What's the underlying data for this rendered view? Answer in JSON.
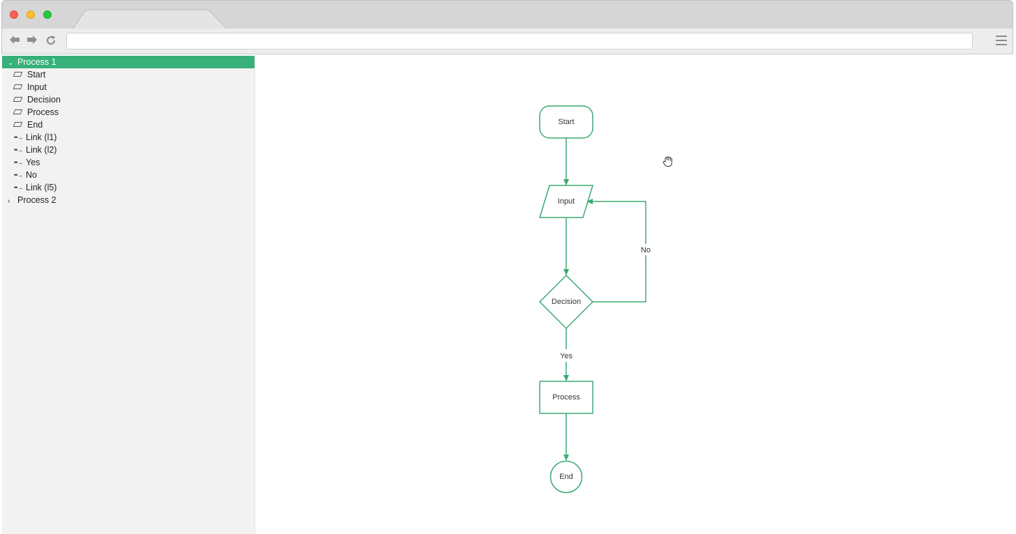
{
  "browser": {
    "url": "",
    "nav": {
      "back": "back-arrow",
      "forward": "forward-arrow",
      "reload": "reload"
    }
  },
  "sidebar": {
    "groups": [
      {
        "label": "Process 1",
        "expanded": true,
        "selected": true,
        "children": [
          {
            "label": "Start",
            "kind": "shape"
          },
          {
            "label": "Input",
            "kind": "shape"
          },
          {
            "label": "Decision",
            "kind": "shape"
          },
          {
            "label": "Process",
            "kind": "shape"
          },
          {
            "label": "End",
            "kind": "shape"
          },
          {
            "label": "Link (l1)",
            "kind": "link"
          },
          {
            "label": "Link (l2)",
            "kind": "link"
          },
          {
            "label": "Yes",
            "kind": "link"
          },
          {
            "label": "No",
            "kind": "link"
          },
          {
            "label": "Link (l5)",
            "kind": "link"
          }
        ]
      },
      {
        "label": "Process 2",
        "expanded": false,
        "selected": false,
        "children": []
      }
    ]
  },
  "diagram": {
    "accent": "#3aaa74",
    "nodes": {
      "start": "Start",
      "input": "Input",
      "decision": "Decision",
      "process": "Process",
      "end": "End"
    },
    "edges": {
      "yes": "Yes",
      "no": "No"
    }
  }
}
